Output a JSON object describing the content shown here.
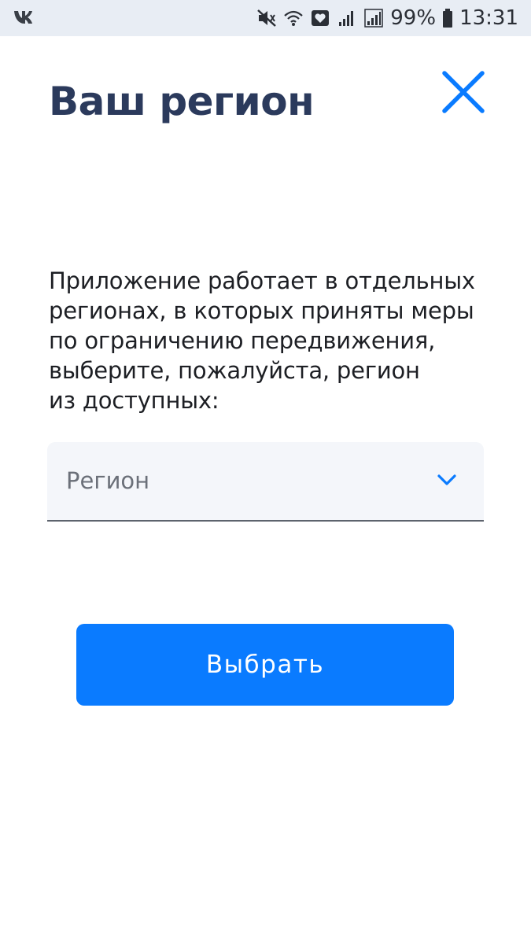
{
  "status_bar": {
    "left_icon": "vk-icon",
    "battery_percent": "99%",
    "time": "13:31",
    "icons": [
      "mute-icon",
      "wifi-icon",
      "heart-app-icon",
      "signal-icon",
      "signal-icon",
      "battery-icon"
    ]
  },
  "header": {
    "title": "Ваш регион",
    "close_icon": "close-icon"
  },
  "main": {
    "description_lines": [
      "Приложение работает в отдельных",
      "регионах, в которых приняты меры",
      "по ограничению передвижения,",
      "выберите, пожалуйста, регион",
      "из доступных:"
    ],
    "region_select": {
      "placeholder": "Регион",
      "icon": "chevron-down-icon"
    },
    "submit_label": "Выбрать"
  },
  "colors": {
    "accent": "#0a7bff",
    "title": "#2b3a5c",
    "status_bar_bg": "#e8edf4",
    "field_bg": "#f4f6fa"
  }
}
